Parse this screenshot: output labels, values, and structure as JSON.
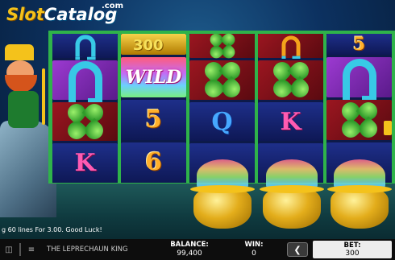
{
  "logo": {
    "part1": "Slot",
    "part2": "Catalog",
    "suffix": ".com"
  },
  "win_amount": "300",
  "reels": [
    [
      "horseshoe",
      "horseshoe",
      "clover",
      "K"
    ],
    [
      "coins",
      "WILD",
      "5",
      "6"
    ],
    [
      "clover",
      "clover",
      "Q",
      "blank"
    ],
    [
      "horseshoe-gold",
      "clover",
      "K",
      "blank"
    ],
    [
      "5",
      "horseshoe",
      "clover",
      "blank"
    ]
  ],
  "symbols": {
    "r1c1_text": "",
    "r2_wild": "WILD",
    "r2_five": "5",
    "r2_six": "6",
    "r3_q": "Q",
    "r4_k": "K",
    "r5_five": "5",
    "r1_k": "K"
  },
  "ticker": "g 60 lines For 3.00. Good Luck!",
  "bottom_bar": {
    "sound_icon": "speaker-icon",
    "game_name": "THE LEPRECHAUN KING",
    "balance_label": "BALANCE:",
    "balance_value": "99,400",
    "win_label": "WIN:",
    "win_value": "0",
    "decrease_label": "❮",
    "bet_label": "BET:",
    "bet_value": "300"
  },
  "colors": {
    "frame_green": "#2fb34a",
    "gold": "#f4c21b",
    "bar_bg": "#0d0d0d"
  }
}
